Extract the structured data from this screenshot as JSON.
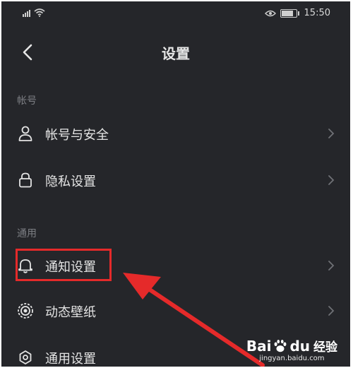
{
  "status_bar": {
    "time": "15:50"
  },
  "header": {
    "title": "设置"
  },
  "sections": [
    {
      "label": "帐号"
    },
    {
      "label": "通用"
    }
  ],
  "rows": [
    {
      "label": "帐号与安全",
      "icon": "user-icon"
    },
    {
      "label": "隐私设置",
      "icon": "lock-icon"
    },
    {
      "label": "通知设置",
      "icon": "bell-icon"
    },
    {
      "label": "动态壁纸",
      "icon": "ripple-icon"
    },
    {
      "label": "通用设置",
      "icon": "gear-icon"
    }
  ],
  "annotation": {
    "highlight_color": "#e52a2a"
  },
  "watermark": {
    "brand_left": "Bai",
    "brand_right": "du",
    "brand_cn": "经验",
    "url": "jingyan.baidu.com"
  },
  "colors": {
    "background": "#25262a",
    "text": "#e4e4e4",
    "muted": "#7d7f84"
  }
}
